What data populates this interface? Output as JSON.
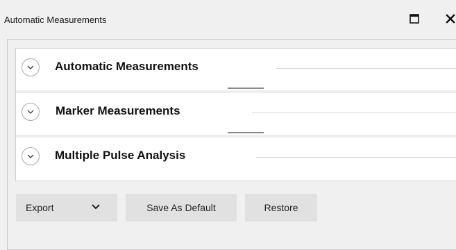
{
  "window": {
    "title": "Automatic Measurements",
    "maximize_icon": "maximize-icon",
    "close_icon": "close-icon"
  },
  "sections": [
    {
      "title": "Automatic Measurements",
      "expander_icon": "chevron-down-icon"
    },
    {
      "title": "Marker Measurements",
      "expander_icon": "chevron-down-icon"
    },
    {
      "title": "Multiple Pulse Analysis",
      "expander_icon": "chevron-down-icon"
    }
  ],
  "toolbar": {
    "export_label": "Export",
    "export_icon": "chevron-down-icon",
    "save_default_label": "Save As Default",
    "restore_label": "Restore"
  },
  "colors": {
    "background": "#f0f0f0",
    "panel": "#ffffff",
    "button": "#e1e1e1",
    "text": "#111111"
  }
}
